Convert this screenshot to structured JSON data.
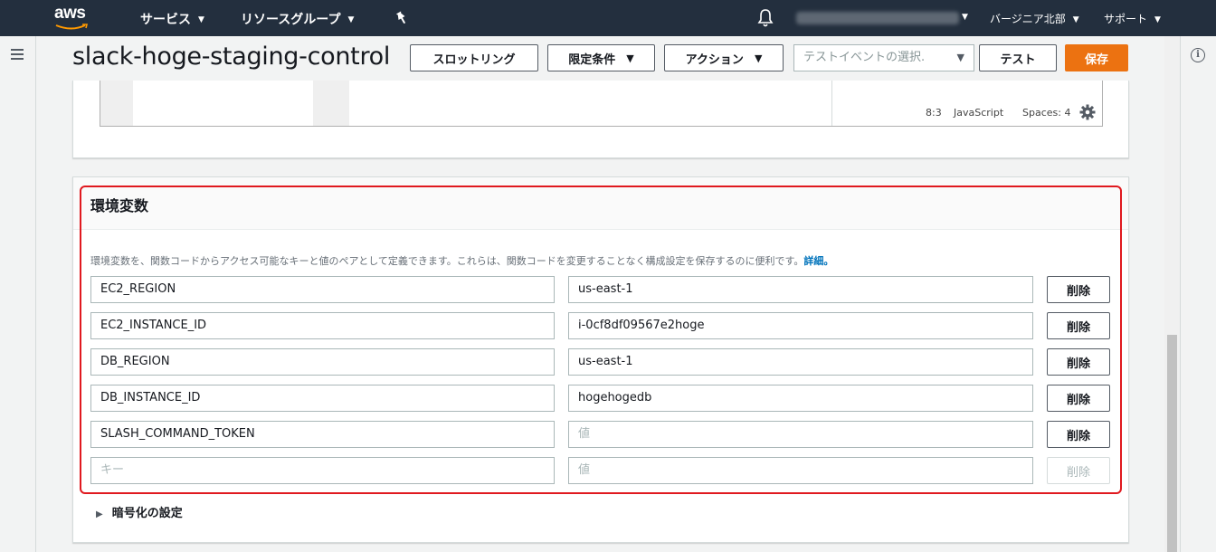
{
  "nav": {
    "logo": "aws",
    "services": "サービス",
    "resource_groups": "リソースグループ",
    "region": "バージニア北部",
    "support": "サポート"
  },
  "header": {
    "title": "slack-hoge-staging-control",
    "throttle": "スロットリング",
    "qualifiers": "限定条件",
    "actions": "アクション",
    "test_event_placeholder": "テストイベントの選択.",
    "test": "テスト",
    "save": "保存"
  },
  "editor": {
    "cursor": "8:3",
    "language": "JavaScript",
    "spaces": "Spaces: 4"
  },
  "env": {
    "title": "環境変数",
    "description": "環境変数を、関数コードからアクセス可能なキーと値のペアとして定義できます。これらは、関数コードを変更することなく構成設定を保存するのに便利です。",
    "details_link": "詳細。",
    "rows": [
      {
        "key": "EC2_REGION",
        "value": "us-east-1",
        "delete": "削除"
      },
      {
        "key": "EC2_INSTANCE_ID",
        "value": "i-0cf8df09567e2hoge",
        "delete": "削除"
      },
      {
        "key": "DB_REGION",
        "value": "us-east-1",
        "delete": "削除"
      },
      {
        "key": "DB_INSTANCE_ID",
        "value": "hogehogedb",
        "delete": "削除"
      },
      {
        "key": "SLASH_COMMAND_TOKEN",
        "value": "",
        "value_placeholder": "値",
        "delete": "削除"
      },
      {
        "key": "",
        "key_placeholder": "キー",
        "value": "",
        "value_placeholder": "値",
        "delete": "削除"
      }
    ],
    "encryption": "暗号化の設定"
  },
  "colors": {
    "nav_bg": "#232f3e",
    "save_bg": "#ec7211",
    "highlight": "#e0191f",
    "link": "#0073bb"
  }
}
